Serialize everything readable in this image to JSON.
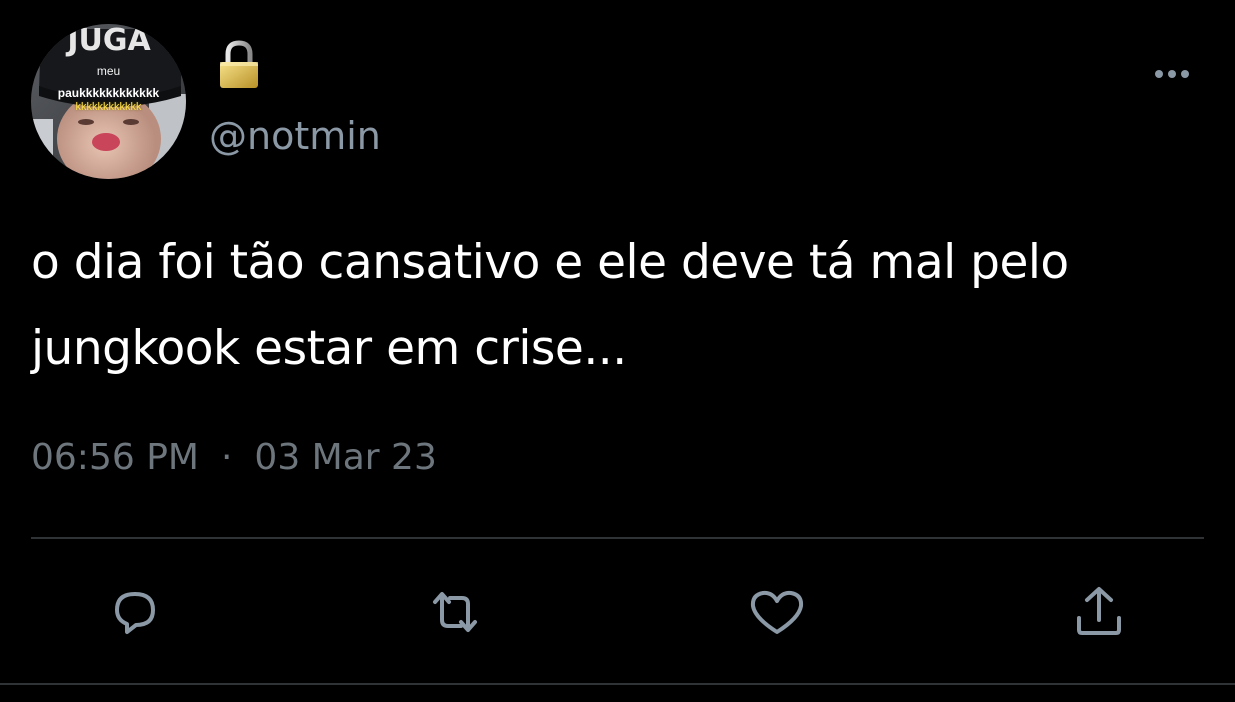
{
  "author": {
    "avatar_caption_lines": [
      "meu",
      "paukkkkkkkkkkkk",
      "kkkkkkkkkkkk"
    ],
    "avatar_cap_text": "JUGA",
    "handle": "@notmin",
    "protected_icon": "lock-icon"
  },
  "tweet": {
    "text": "o dia foi tão cansativo e ele deve tá mal pelo jungkook estar em crise...",
    "time": "06:56 PM",
    "separator": "·",
    "date": "03 Mar 23"
  },
  "menu": {
    "icon": "more-options-icon"
  },
  "actions": [
    {
      "name": "reply",
      "icon": "reply-icon"
    },
    {
      "name": "retweet",
      "icon": "retweet-icon"
    },
    {
      "name": "like",
      "icon": "heart-icon"
    },
    {
      "name": "share",
      "icon": "share-icon"
    }
  ],
  "colors": {
    "background": "#000000",
    "text": "#ffffff",
    "secondary_text": "#6e767d",
    "handle_text": "#8b98a5",
    "divider": "#2f3336",
    "icon": "#8b98a5"
  }
}
